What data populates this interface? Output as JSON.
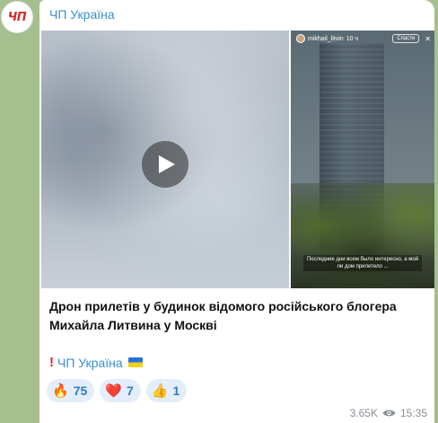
{
  "channel": {
    "avatar_text": "ЧП",
    "name": "ЧП Україна"
  },
  "media": {
    "story_username": "mikhail_litvin",
    "story_time": "10 ч",
    "story_button": "Спасти",
    "story_caption": "Последние дни всем было интересно, а мой ли дом прилетело ..."
  },
  "post": {
    "title": "Дрон прилетів у будинок відомого російського блогера Михайла Литвина у Москві",
    "signature_link": "ЧП Україна"
  },
  "reactions": [
    {
      "emoji": "🔥",
      "count": "75"
    },
    {
      "emoji": "❤️",
      "count": "7"
    },
    {
      "emoji": "👍",
      "count": "1"
    }
  ],
  "meta": {
    "views": "3.65K",
    "time": "15:35"
  },
  "colors": {
    "accent": "#3a8fd1",
    "reaction_bg": "#e3eefa",
    "avatar_red": "#d42c2c"
  }
}
